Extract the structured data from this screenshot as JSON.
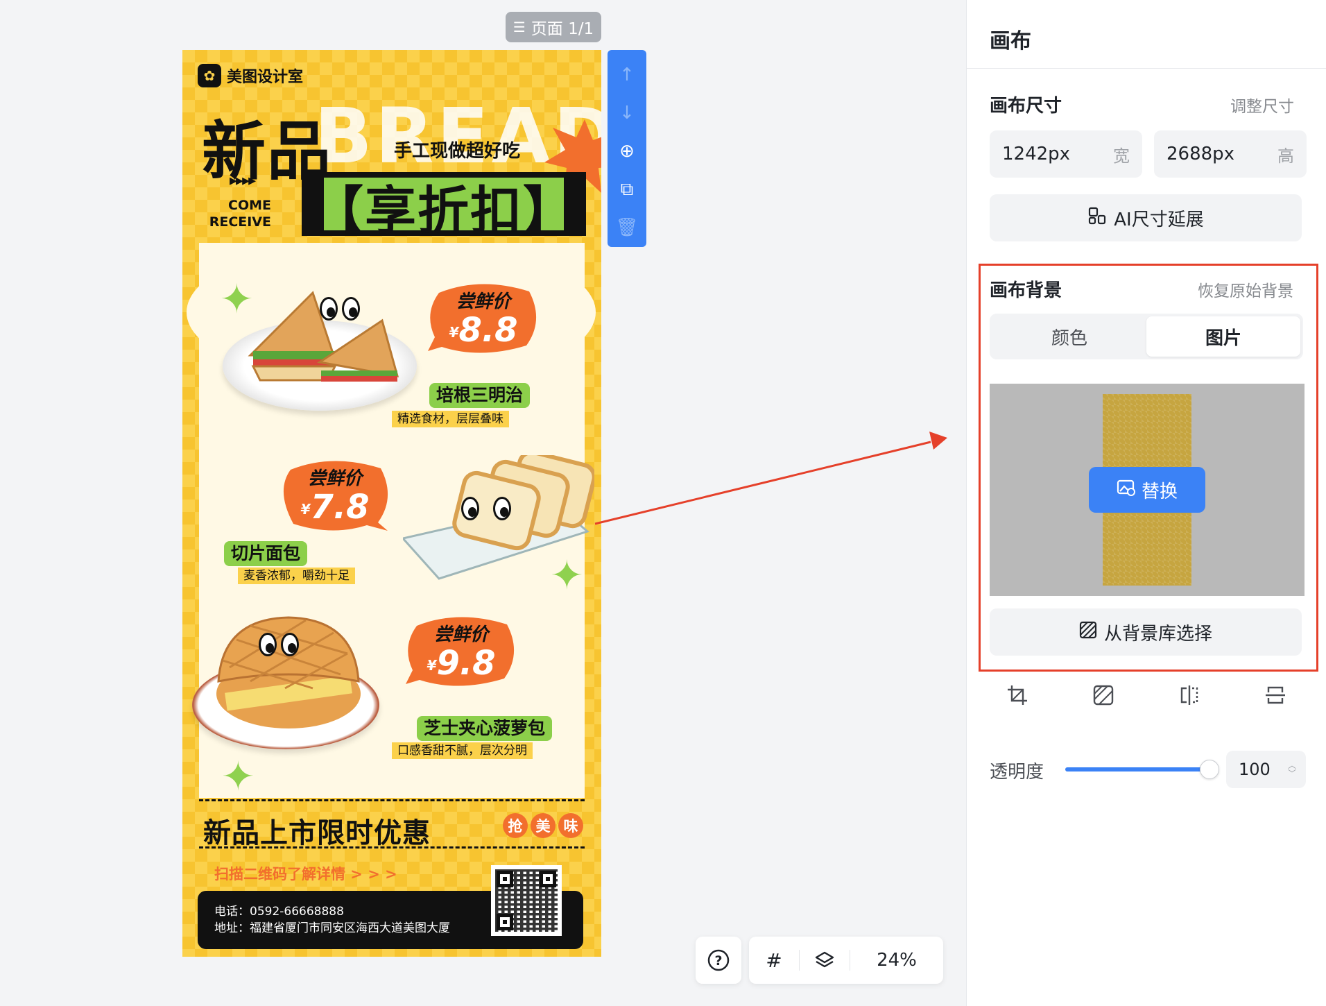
{
  "workspace": {
    "page_indicator": "页面 1/1",
    "zoom": "24%"
  },
  "poster": {
    "brand": "美图设计室",
    "headline": "新品",
    "bg_word": "BREAD",
    "slogan": "手工现做超好吃",
    "arrows": "▸▸▸▸",
    "come": "COME",
    "receive": "RECEIVE",
    "discount": "【享折扣】",
    "items": [
      {
        "price_title": "尝鲜价",
        "currency": "¥",
        "price": "8.8",
        "name": "培根三明治",
        "desc": "精选食材，层层叠味"
      },
      {
        "price_title": "尝鲜价",
        "currency": "¥",
        "price": "7.8",
        "name": "切片面包",
        "desc": "麦香浓郁，嚼劲十足"
      },
      {
        "price_title": "尝鲜价",
        "currency": "¥",
        "price": "9.8",
        "name": "芝士夹心菠萝包",
        "desc": "口感香甜不腻，层次分明"
      }
    ],
    "limited": "新品上市限时优惠",
    "chips": [
      "抢",
      "美",
      "味"
    ],
    "scan": "扫描二维码了解详情 > > >",
    "phone": "电话：0592-66668888",
    "address": "地址：福建省厦门市同安区海西大道美图大厦"
  },
  "panel": {
    "title": "画布",
    "size_section": "画布尺寸",
    "resize_link": "调整尺寸",
    "width_value": "1242px",
    "width_unit": "宽",
    "height_value": "2688px",
    "height_unit": "高",
    "ai_extend": "AI尺寸延展",
    "bg_section": "画布背景",
    "restore_link": "恢复原始背景",
    "tabs": [
      "颜色",
      "图片"
    ],
    "active_tab": "图片",
    "replace": "替换",
    "bg_library": "从背景库选择",
    "opacity_label": "透明度",
    "opacity_value": "100",
    "opacity_fraction": 1.0
  },
  "colors": {
    "accent": "#3b82f6",
    "highlight": "#e5402a",
    "poster_yellow": "#fbd14b",
    "poster_orange": "#f26f2d",
    "poster_green": "#8ccf4a"
  }
}
